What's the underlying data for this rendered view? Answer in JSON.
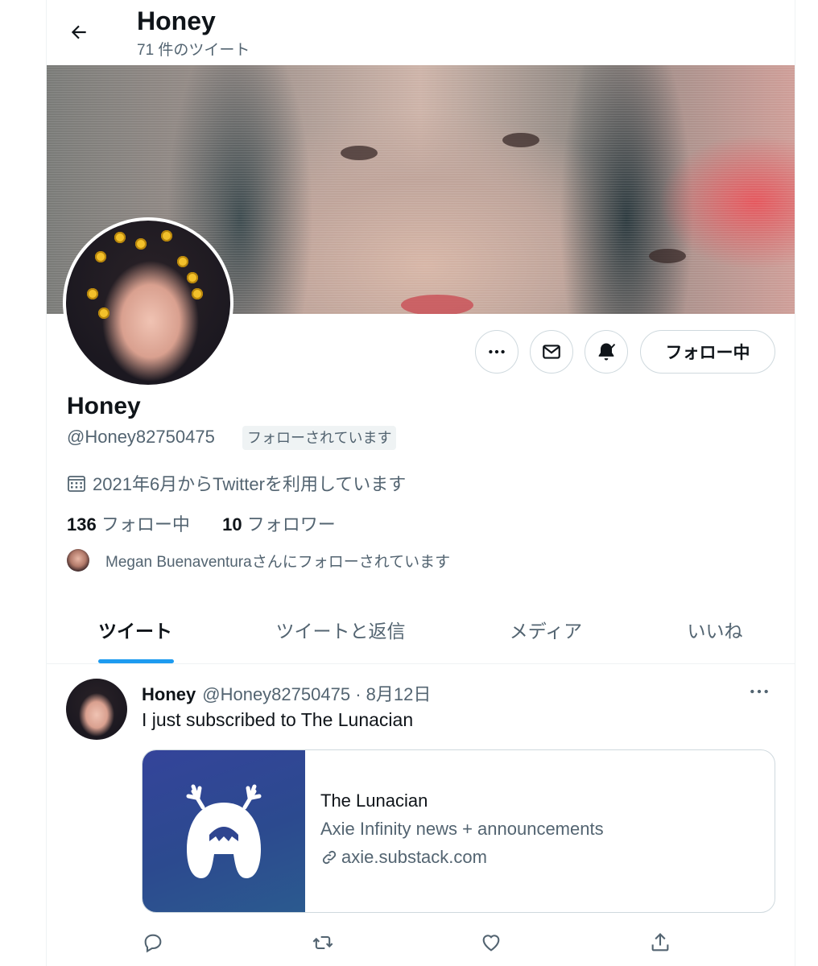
{
  "header": {
    "title": "Honey",
    "tweet_count": "71 件のツイート"
  },
  "profile": {
    "name": "Honey",
    "handle": "@Honey82750475",
    "follows_you_badge": "フォローされています",
    "joined": "2021年6月からTwitterを利用しています",
    "following_count": "136",
    "following_label": "フォロー中",
    "followers_count": "10",
    "followers_label": "フォロワー",
    "followed_by": "Megan Buenaventuraさんにフォローされています",
    "follow_button_label": "フォロー中"
  },
  "tabs": [
    {
      "label": "ツイート"
    },
    {
      "label": "ツイートと返信"
    },
    {
      "label": "メディア"
    },
    {
      "label": "いいね"
    }
  ],
  "tweet": {
    "author_name": "Honey",
    "author_handle": "@Honey82750475",
    "separator": "·",
    "date": "8月12日",
    "text": "I just subscribed to The Lunacian",
    "card": {
      "title": "The Lunacian",
      "description": "Axie Infinity news + announcements",
      "url": "axie.substack.com"
    }
  },
  "icons": {
    "back": "arrow-left-icon",
    "more": "more-dots-icon",
    "message": "envelope-icon",
    "notifications": "bell-check-icon",
    "calendar": "calendar-icon",
    "link": "link-icon",
    "reply": "reply-icon",
    "retweet": "retweet-icon",
    "like": "heart-icon",
    "share": "share-icon"
  },
  "colors": {
    "accent": "#1d9bf0",
    "text": "#0f1419",
    "secondary_text": "#536471",
    "border": "#cfd9de"
  }
}
